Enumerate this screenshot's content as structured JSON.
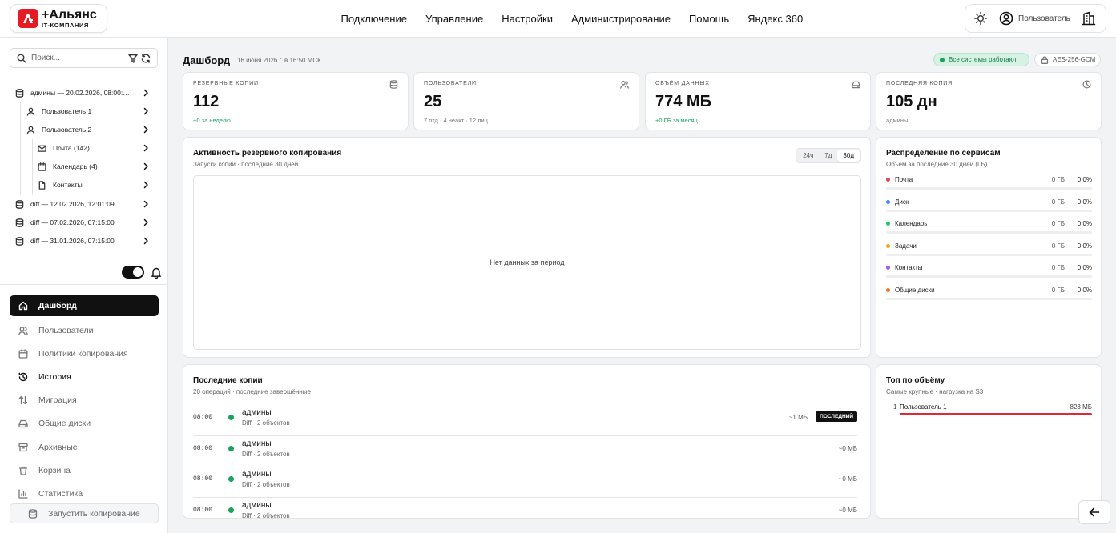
{
  "brand": {
    "name": "+Альянс",
    "subtitle": "IT-КОМПАНИЯ",
    "color": "#e51b23"
  },
  "nav": [
    "Подключение",
    "Управление",
    "Настройки",
    "Администрирование",
    "Помощь",
    "Яндекс 360"
  ],
  "header_right": {
    "user_label": "Пользователь",
    "theme_icon": "sun-icon",
    "building_icon": "building-icon"
  },
  "sidebar": {
    "search_placeholder": "Поиск...",
    "tree": [
      {
        "label": "админы — 20.02.2026, 08:00:…",
        "icon": "database-icon",
        "level": 0
      },
      {
        "label": "Пользователь 1",
        "icon": "user-icon",
        "level": 1
      },
      {
        "label": "Пользователь 2",
        "icon": "user-icon",
        "level": 1
      },
      {
        "label": "Почта (142)",
        "icon": "mail-icon",
        "level": 2
      },
      {
        "label": "Календарь (4)",
        "icon": "calendar-icon",
        "level": 2
      },
      {
        "label": "Контакты",
        "icon": "file-icon",
        "level": 2
      },
      {
        "label": "diff — 12.02.2026, 12:01:09",
        "icon": "database-icon",
        "level": 0
      },
      {
        "label": "diff — 07.02.2026, 07:15:00",
        "icon": "database-icon",
        "level": 0
      },
      {
        "label": "diff — 31.01.2026, 07:15:00",
        "icon": "database-icon",
        "level": 0
      }
    ],
    "toggle_on": true,
    "menu": [
      {
        "label": "Дашборд",
        "icon": "home-icon",
        "active": true
      },
      {
        "label": "Пользователи",
        "icon": "users-icon"
      },
      {
        "label": "Политики копирования",
        "icon": "calendar-icon"
      },
      {
        "label": "История",
        "icon": "history-icon",
        "bold": true
      },
      {
        "label": "Миграция",
        "icon": "arrows-icon"
      },
      {
        "label": "Общие диски",
        "icon": "drive-icon"
      },
      {
        "label": "Архивные",
        "icon": "archive-icon"
      },
      {
        "label": "Корзина",
        "icon": "trash-icon"
      },
      {
        "label": "Статистика",
        "icon": "chart-icon"
      }
    ],
    "run_button": "Запустить копирование"
  },
  "page": {
    "title": "Дашборд",
    "date": "16 июня 2026 г. в 16:50 МСК",
    "status_badge": "Все системы работают",
    "encryption_badge": "AES-256-GCM"
  },
  "stats": [
    {
      "label": "Резервные копии",
      "value": "112",
      "sub": "+0 за неделю",
      "sub_green": true,
      "icon": "database-icon"
    },
    {
      "label": "Пользователи",
      "value": "25",
      "sub": "7 отд · 4 неакт · 12 лиц",
      "sub_green": false,
      "icon": "users-icon"
    },
    {
      "label": "Объём данных",
      "value": "774 МБ",
      "sub": "+0 ГБ за месяц",
      "sub_green": true,
      "icon": "drive-icon"
    },
    {
      "label": "Последняя копия",
      "value": "105 дн",
      "sub": "админы",
      "sub_green": false,
      "icon": "clock-icon"
    }
  ],
  "activity": {
    "title": "Активность резервного копирования",
    "subtitle": "Запуски копий · последние 30 дней",
    "ranges": [
      "24ч",
      "7д",
      "30д"
    ],
    "selected_range": "30д",
    "empty_text": "Нет данных за период"
  },
  "distribution": {
    "title": "Распределение по сервисам",
    "subtitle": "Объём за последние 30 дней (ГБ)",
    "items": [
      {
        "name": "Почта",
        "gb": "0 ГБ",
        "pct": "0.0%",
        "color": "#e0444c"
      },
      {
        "name": "Диск",
        "gb": "0 ГБ",
        "pct": "0.0%",
        "color": "#3b82f6"
      },
      {
        "name": "Календарь",
        "gb": "0 ГБ",
        "pct": "0.0%",
        "color": "#22c55e"
      },
      {
        "name": "Задачи",
        "gb": "0 ГБ",
        "pct": "0.0%",
        "color": "#f59e0b"
      },
      {
        "name": "Контакты",
        "gb": "0 ГБ",
        "pct": "0.0%",
        "color": "#a855f7"
      },
      {
        "name": "Общие диски",
        "gb": "0 ГБ",
        "pct": "0.0%",
        "color": "#f97316"
      }
    ]
  },
  "recent": {
    "title": "Последние копии",
    "subtitle": "20 операций · последние завершённые",
    "latest_tag": "ПОСЛЕДНИЙ",
    "items": [
      {
        "time": "08:00",
        "name": "админы",
        "meta": "Diff · 2 объектов",
        "size": "~1 МБ",
        "latest": true
      },
      {
        "time": "08:00",
        "name": "админы",
        "meta": "Diff · 2 объектов",
        "size": "~0 МБ",
        "latest": false
      },
      {
        "time": "08:00",
        "name": "админы",
        "meta": "Diff · 2 объектов",
        "size": "~0 МБ",
        "latest": false
      },
      {
        "time": "08:00",
        "name": "админы",
        "meta": "Diff · 2 объектов",
        "size": "~0 МБ",
        "latest": false
      }
    ]
  },
  "top": {
    "title": "Топ по объёму",
    "subtitle": "Самые крупные · нагрузка на S3",
    "items": [
      {
        "rank": "1",
        "name": "Пользователь 1",
        "size": "823 МБ",
        "fraction": 1.0
      }
    ]
  },
  "colors": {
    "accent": "#111111",
    "success": "#1aa35a",
    "danger": "#dc2b36"
  }
}
